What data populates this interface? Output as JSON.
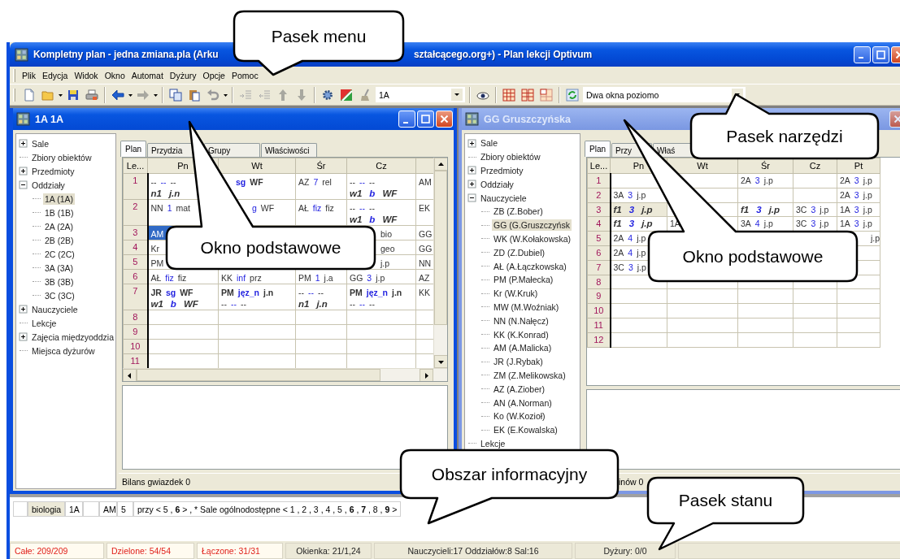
{
  "window": {
    "title_parts": [
      "Kompletny plan - jedna zmiana.pla (Arku",
      "ształcącego.org+) - Plan lekcji Optivum"
    ]
  },
  "menu": [
    "Plik",
    "Edycja",
    "Widok",
    "Okno",
    "Automat",
    "Dyżury",
    "Opcje",
    "Pomoc"
  ],
  "toolbar": {
    "class_combo": "1A",
    "layout_combo": "Dwa okna poziomo"
  },
  "child_windows": [
    {
      "title": "1A 1A",
      "active": true,
      "tree": [
        {
          "label": "Sale",
          "expanded": false,
          "selected": false
        },
        {
          "label": "Zbiory obiektów",
          "selected": false
        },
        {
          "label": "Przedmioty",
          "expanded": false,
          "selected": false
        },
        {
          "label": "Oddziały",
          "expanded": true,
          "selected": false,
          "children": [
            {
              "label": "1A (1A)",
              "selected": true
            },
            {
              "label": "1B (1B)",
              "selected": false
            },
            {
              "label": "2A (2A)",
              "selected": false
            },
            {
              "label": "2B (2B)",
              "selected": false
            },
            {
              "label": "2C (2C)",
              "selected": false
            },
            {
              "label": "3A (3A)",
              "selected": false
            },
            {
              "label": "3B (3B)",
              "selected": false
            },
            {
              "label": "3C (3C)",
              "selected": false
            }
          ]
        },
        {
          "label": "Nauczyciele",
          "expanded": false,
          "selected": false
        },
        {
          "label": "Lekcje",
          "selected": false
        },
        {
          "label": "Zajęcia międzyoddzia",
          "expanded": false,
          "selected": false
        },
        {
          "label": "Miejsca dyżurów",
          "selected": false
        }
      ],
      "tabs": [
        {
          "label": "Plan",
          "selected": true
        },
        {
          "label": "Przydzia",
          "selected": false
        },
        {
          "label": "Grupy",
          "selected": false
        },
        {
          "label": "Właściwości",
          "selected": false
        }
      ],
      "grid": {
        "corner": "Le...",
        "columns": [
          "Pn",
          "Wt",
          "Śr",
          "Cz"
        ],
        "rows": [
          {
            "label": "1",
            "cells": [
              {
                "selected": false,
                "lines": [
                  {
                    "kind": "plain",
                    "teacher": "--",
                    "room": "--",
                    "subject": "--"
                  },
                  {
                    "kind": "group",
                    "teacher": "n1",
                    "subject": "j.n"
                  }
                ]
              },
              {
                "selected": false,
                "lines": [
                  {
                    "kind": "boldtail",
                    "room": "sg",
                    "subject": "WF"
                  }
                ]
              },
              {
                "selected": false,
                "lines": [
                  {
                    "kind": "plain",
                    "teacher": "AZ",
                    "room": "7",
                    "subject": "rel"
                  }
                ]
              },
              {
                "selected": false,
                "lines": [
                  {
                    "kind": "plain",
                    "teacher": "--",
                    "room": "--",
                    "subject": "--"
                  },
                  {
                    "kind": "group",
                    "teacher": "w1",
                    "room": "b",
                    "subject": "WF"
                  }
                ]
              },
              {
                "selected": false,
                "lines": [
                  {
                    "kind": "plain",
                    "teacher": "AM"
                  }
                ]
              }
            ]
          },
          {
            "label": "2",
            "cells": [
              {
                "selected": false,
                "lines": [
                  {
                    "kind": "plain",
                    "teacher": "NN",
                    "room": "1",
                    "subject": "mat"
                  }
                ]
              },
              {
                "selected": false,
                "lines": [
                  {
                    "kind": "tail",
                    "room": "g",
                    "subject": "WF"
                  }
                ]
              },
              {
                "selected": false,
                "lines": [
                  {
                    "kind": "plain",
                    "teacher": "AŁ",
                    "room": "fiz",
                    "subject": "fiz"
                  }
                ]
              },
              {
                "selected": false,
                "lines": [
                  {
                    "kind": "plain",
                    "teacher": "--",
                    "room": "--",
                    "subject": "--"
                  },
                  {
                    "kind": "group",
                    "teacher": "w1",
                    "room": "b",
                    "subject": "WF"
                  }
                ]
              },
              {
                "selected": false,
                "lines": [
                  {
                    "kind": "plain",
                    "teacher": "EK"
                  }
                ]
              }
            ]
          },
          {
            "label": "3",
            "cells": [
              {
                "selected": true,
                "lines": [
                  {
                    "kind": "plain",
                    "teacher": "AM"
                  }
                ]
              },
              {},
              {},
              {
                "selected": false,
                "lines": [
                  {
                    "kind": "tail",
                    "subject": "bio"
                  }
                ]
              },
              {
                "selected": false,
                "lines": [
                  {
                    "kind": "plain",
                    "teacher": "GG"
                  }
                ]
              }
            ]
          },
          {
            "label": "4",
            "cells": [
              {
                "selected": false,
                "lines": [
                  {
                    "kind": "plain",
                    "teacher": "Kr"
                  }
                ]
              },
              {},
              {},
              {
                "selected": false,
                "lines": [
                  {
                    "kind": "tail",
                    "subject": "geo"
                  }
                ]
              },
              {
                "selected": false,
                "lines": [
                  {
                    "kind": "plain",
                    "teacher": "GG"
                  }
                ]
              }
            ]
          },
          {
            "label": "5",
            "cells": [
              {
                "selected": false,
                "lines": [
                  {
                    "kind": "plain",
                    "teacher": "PM"
                  }
                ]
              },
              {},
              {},
              {
                "selected": false,
                "lines": [
                  {
                    "kind": "tail",
                    "subject": "j.p"
                  }
                ]
              },
              {
                "selected": false,
                "lines": [
                  {
                    "kind": "plain",
                    "teacher": "NN"
                  }
                ]
              }
            ]
          },
          {
            "label": "6",
            "cells": [
              {
                "selected": false,
                "lines": [
                  {
                    "kind": "plain",
                    "teacher": "AŁ",
                    "room": "fiz",
                    "subject": "fiz"
                  }
                ]
              },
              {
                "selected": false,
                "lines": [
                  {
                    "kind": "plain",
                    "teacher": "KK",
                    "room": "inf",
                    "subject": "prz"
                  }
                ]
              },
              {
                "selected": false,
                "lines": [
                  {
                    "kind": "plain",
                    "teacher": "PM",
                    "room": "1",
                    "subject": "j.a"
                  }
                ]
              },
              {
                "selected": false,
                "lines": [
                  {
                    "kind": "plain",
                    "teacher": "GG",
                    "room": "3",
                    "subject": "j.p"
                  }
                ]
              },
              {
                "selected": false,
                "lines": [
                  {
                    "kind": "plain",
                    "teacher": "AZ"
                  }
                ]
              }
            ]
          },
          {
            "label": "7",
            "cells": [
              {
                "selected": false,
                "lines": [
                  {
                    "kind": "bold",
                    "teacher": "JR",
                    "room": "sg",
                    "subject": "WF"
                  },
                  {
                    "kind": "group",
                    "teacher": "w1",
                    "room": "b",
                    "subject": "WF"
                  }
                ]
              },
              {
                "selected": false,
                "lines": [
                  {
                    "kind": "bold",
                    "teacher": "PM",
                    "room": "jęz_n",
                    "subject": "j.n"
                  },
                  {
                    "kind": "plain",
                    "teacher": "--",
                    "room": "--",
                    "subject": "--"
                  }
                ]
              },
              {
                "selected": false,
                "lines": [
                  {
                    "kind": "plain",
                    "teacher": "--",
                    "room": "--",
                    "subject": "--"
                  },
                  {
                    "kind": "group",
                    "teacher": "n1",
                    "subject": "j.n"
                  }
                ]
              },
              {
                "selected": false,
                "lines": [
                  {
                    "kind": "bold",
                    "teacher": "PM",
                    "room": "jęz_n",
                    "subject": "j.n"
                  },
                  {
                    "kind": "plain",
                    "teacher": "--",
                    "room": "--",
                    "subject": "--"
                  }
                ]
              },
              {
                "selected": false,
                "lines": [
                  {
                    "kind": "plain",
                    "teacher": "KK"
                  }
                ]
              }
            ]
          },
          {
            "label": "8",
            "cells": [
              {
                "selected": false
              },
              {
                "selected": false
              },
              {
                "selected": false
              },
              {
                "selected": false
              },
              {
                "selected": false
              }
            ]
          },
          {
            "label": "9",
            "cells": [
              {
                "selected": false
              },
              {
                "selected": false
              },
              {
                "selected": false
              },
              {
                "selected": false
              },
              {
                "selected": false
              }
            ]
          },
          {
            "label": "10",
            "cells": [
              {
                "selected": false
              },
              {
                "selected": false
              },
              {
                "selected": false
              },
              {
                "selected": false
              },
              {
                "selected": false
              }
            ]
          },
          {
            "label": "11",
            "cells": [
              {
                "selected": false
              },
              {
                "selected": false
              },
              {
                "selected": false
              },
              {
                "selected": false
              },
              {
                "selected": false
              }
            ]
          }
        ]
      },
      "status": "Bilans gwiazdek 0"
    },
    {
      "title": "GG Gruszczyńska",
      "active": false,
      "tree": [
        {
          "label": "Sale",
          "expanded": false,
          "selected": false
        },
        {
          "label": "Zbiory obiektów",
          "selected": false
        },
        {
          "label": "Przedmioty",
          "expanded": false,
          "selected": false
        },
        {
          "label": "Oddziały",
          "expanded": false,
          "selected": false
        },
        {
          "label": "Nauczyciele",
          "expanded": true,
          "selected": false,
          "children": [
            {
              "label": "ZB (Z.Bober)",
              "selected": false
            },
            {
              "label": "GG (G.Gruszczyńsk",
              "selected": true
            },
            {
              "label": "WK (W.Kołakowska)",
              "selected": false
            },
            {
              "label": "ZD (Z.Dubiel)",
              "selected": false
            },
            {
              "label": "AŁ (A.Łączkowska)",
              "selected": false
            },
            {
              "label": "PM (P.Małecka)",
              "selected": false
            },
            {
              "label": "Kr (W.Kruk)",
              "selected": false
            },
            {
              "label": "MW (M.Woźniak)",
              "selected": false
            },
            {
              "label": "NN (N.Nałęcz)",
              "selected": false
            },
            {
              "label": "KK (K.Konrad)",
              "selected": false
            },
            {
              "label": "AM (A.Malicka)",
              "selected": false
            },
            {
              "label": "JR (J.Rybak)",
              "selected": false
            },
            {
              "label": "ZM (Z.Melikowska)",
              "selected": false
            },
            {
              "label": "AZ (A.Ziober)",
              "selected": false
            },
            {
              "label": "AN (A.Norman)",
              "selected": false
            },
            {
              "label": "Ko (W.Kozioł)",
              "selected": false
            },
            {
              "label": "EK (E.Kowalska)",
              "selected": false
            }
          ]
        },
        {
          "label": "Lekcje",
          "selected": false
        }
      ],
      "tabs": [
        {
          "label": "Plan",
          "selected": true
        },
        {
          "label": "Przy",
          "selected": false
        },
        {
          "label": "Właś",
          "selected": false
        }
      ],
      "grid": {
        "corner": "Le...",
        "columns": [
          "Pn",
          "Wt",
          "Śr",
          "Cz",
          "Pt"
        ],
        "rows": [
          {
            "label": "1",
            "cells": [
              {
                "selected": false
              },
              {
                "selected": false
              },
              {
                "selected": false,
                "lines": [
                  {
                    "kind": "plain",
                    "teacher": "2A",
                    "room": "3",
                    "subject": "j.p"
                  }
                ]
              },
              {
                "selected": false
              },
              {
                "selected": false,
                "lines": [
                  {
                    "kind": "plain",
                    "teacher": "2A",
                    "room": "3",
                    "subject": "j.p"
                  }
                ]
              }
            ]
          },
          {
            "label": "2",
            "cells": [
              {
                "selected": false,
                "lines": [
                  {
                    "kind": "plain",
                    "teacher": "3A",
                    "room": "3",
                    "subject": "j.p"
                  }
                ]
              },
              {
                "selected": false
              },
              {
                "selected": false
              },
              {
                "selected": false
              },
              {
                "selected": false,
                "lines": [
                  {
                    "kind": "plain",
                    "teacher": "2A",
                    "room": "3",
                    "subject": "j.p"
                  }
                ]
              }
            ]
          },
          {
            "label": "3",
            "cells": [
              {
                "selected": true,
                "lines": [
                  {
                    "kind": "group",
                    "teacher": "f1",
                    "room": "3",
                    "subject": "j.p"
                  }
                ]
              },
              {
                "selected": false
              },
              {
                "selected": false,
                "lines": [
                  {
                    "kind": "group",
                    "teacher": "f1",
                    "room": "3",
                    "subject": "j.p"
                  }
                ]
              },
              {
                "selected": false,
                "lines": [
                  {
                    "kind": "plain",
                    "teacher": "3C",
                    "room": "3",
                    "subject": "j.p"
                  }
                ]
              },
              {
                "selected": false,
                "lines": [
                  {
                    "kind": "plain",
                    "teacher": "1A",
                    "room": "3",
                    "subject": "j.p"
                  }
                ]
              }
            ]
          },
          {
            "label": "4",
            "cells": [
              {
                "selected": false,
                "lines": [
                  {
                    "kind": "group",
                    "teacher": "f1",
                    "room": "3",
                    "subject": "j.p"
                  }
                ]
              },
              {
                "selected": false,
                "lines": [
                  {
                    "kind": "plain",
                    "teacher": "1A"
                  }
                ]
              },
              {
                "selected": false,
                "lines": [
                  {
                    "kind": "plain",
                    "teacher": "3A",
                    "room": "4",
                    "subject": "j.p"
                  }
                ]
              },
              {
                "selected": false,
                "lines": [
                  {
                    "kind": "plain",
                    "teacher": "3C",
                    "room": "3",
                    "subject": "j.p"
                  }
                ]
              },
              {
                "selected": false,
                "lines": [
                  {
                    "kind": "plain",
                    "teacher": "1A",
                    "room": "3",
                    "subject": "j.p"
                  }
                ]
              }
            ]
          },
          {
            "label": "5",
            "cells": [
              {
                "selected": false,
                "lines": [
                  {
                    "kind": "plain",
                    "teacher": "2A",
                    "room": "4",
                    "subject": "j.p"
                  }
                ]
              },
              {},
              {},
              {},
              {
                "selected": false,
                "lines": [
                  {
                    "kind": "tail",
                    "subject": "j.p"
                  }
                ]
              }
            ]
          },
          {
            "label": "6",
            "cells": [
              {
                "selected": false,
                "lines": [
                  {
                    "kind": "plain",
                    "teacher": "2A",
                    "room": "4",
                    "subject": "j.p"
                  }
                ]
              },
              {},
              {},
              {},
              {
                "selected": false
              }
            ]
          },
          {
            "label": "7",
            "cells": [
              {
                "selected": false,
                "lines": [
                  {
                    "kind": "plain",
                    "teacher": "3C",
                    "room": "3",
                    "subject": "j.p"
                  }
                ]
              },
              {},
              {},
              {},
              {
                "selected": false
              }
            ]
          },
          {
            "label": "8",
            "cells": [
              {
                "selected": false
              },
              {
                "selected": false
              },
              {
                "selected": false
              },
              {
                "selected": false
              },
              {
                "selected": false
              }
            ]
          },
          {
            "label": "9",
            "cells": [
              {
                "selected": false
              },
              {
                "selected": false
              },
              {
                "selected": false
              },
              {
                "selected": false
              },
              {
                "selected": false
              }
            ]
          },
          {
            "label": "10",
            "cells": [
              {
                "selected": false
              },
              {
                "selected": false
              },
              {
                "selected": false
              },
              {
                "selected": false
              },
              {
                "selected": false
              }
            ]
          },
          {
            "label": "11",
            "cells": [
              {
                "selected": false
              },
              {
                "selected": false
              },
              {
                "selected": false
              },
              {
                "selected": false
              },
              {
                "selected": false
              }
            ]
          },
          {
            "label": "12",
            "cells": [
              {
                "selected": false
              },
              {
                "selected": false
              },
              {
                "selected": false
              },
              {
                "selected": false
              },
              {
                "selected": false
              }
            ]
          }
        ]
      },
      "status": "inów 0"
    }
  ],
  "info_row": {
    "cells": [
      "biologia",
      "1A",
      "AM",
      "5"
    ],
    "note": "przy < 5 , **6** > , * Sale ogólnodostępne < 1 , 2 , 3 , 4 , 5 , **6** , **7** , 8 , **9** >"
  },
  "status_bar": [
    {
      "text": "Całe: 209/209",
      "alert": true
    },
    {
      "text": "Dzielone: 54/54",
      "alert": true
    },
    {
      "text": "Łączone: 31/31",
      "alert": true
    },
    {
      "text": "Okienka: 21/1,24",
      "alert": false
    },
    {
      "text": "Nauczycieli:17 Oddziałów:8 Sal:16",
      "alert": false
    },
    {
      "text": "Dyżury: 0/0",
      "alert": false
    }
  ],
  "callouts": [
    {
      "text": "Pasek menu"
    },
    {
      "text": "Pasek narzędzi"
    },
    {
      "text": "Okno podstawowe"
    },
    {
      "text": "Okno podstawowe"
    },
    {
      "text": "Obszar informacyjny"
    },
    {
      "text": "Pasek stanu"
    }
  ]
}
